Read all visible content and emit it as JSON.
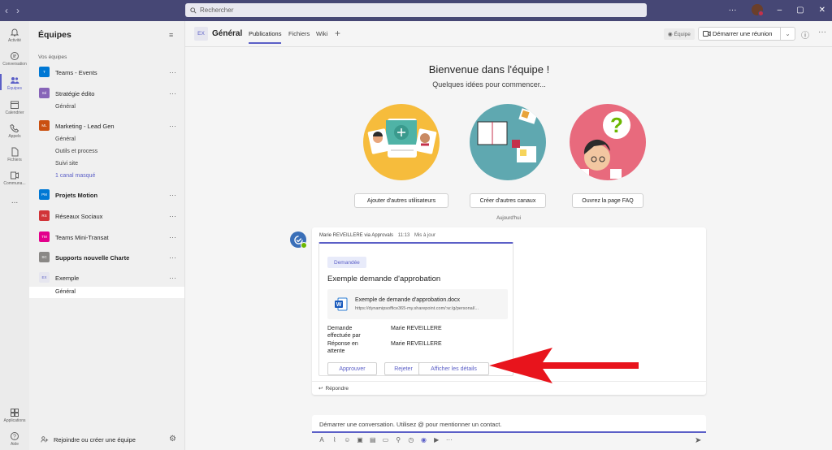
{
  "search": {
    "placeholder": "Rechercher"
  },
  "rail": [
    {
      "label": "Activité",
      "icon": "bell-icon"
    },
    {
      "label": "Conversation",
      "icon": "chat-icon"
    },
    {
      "label": "Équipes",
      "icon": "teams-icon",
      "active": true
    },
    {
      "label": "Calendrier",
      "icon": "calendar-icon"
    },
    {
      "label": "Appels",
      "icon": "phone-icon"
    },
    {
      "label": "Fichiers",
      "icon": "file-icon"
    },
    {
      "label": "Communa...",
      "icon": "communities-icon"
    },
    {
      "label": "...",
      "icon": "more-icon"
    },
    {
      "label": "Applications",
      "icon": "apps-icon"
    },
    {
      "label": "Aide",
      "icon": "help-icon"
    }
  ],
  "teams_panel": {
    "title": "Équipes",
    "section": "Vos équipes",
    "teams": [
      {
        "initials": "T",
        "name": "Teams - Events",
        "color": "#0078d4",
        "bold": false
      },
      {
        "initials": "Sé",
        "name": "Stratégie édito",
        "color": "#8764b8",
        "bold": false
      },
      {
        "initials": "ML",
        "name": "Marketing - Lead Gen",
        "color": "#ca5010",
        "bold": false
      },
      {
        "initials": "PM",
        "name": "Projets Motion",
        "color": "#0078d4",
        "bold": true
      },
      {
        "initials": "RS",
        "name": "Réseaux Sociaux",
        "color": "#d13438",
        "bold": false
      },
      {
        "initials": "TM",
        "name": "Teams Mini-Transat",
        "color": "#e3008c",
        "bold": false
      },
      {
        "initials": "SC",
        "name": "Supports nouvelle Charte",
        "color": "#8a8886",
        "bold": true
      },
      {
        "initials": "EX",
        "name": "Exemple",
        "color": "#e6e6ef",
        "bold": false
      }
    ],
    "channels": {
      "strategie": [
        "Général"
      ],
      "marketing": [
        "Général",
        "Outils et process",
        "Suivi site",
        "1 canal masqué"
      ],
      "exemple": [
        "Général"
      ]
    },
    "footer": "Rejoindre ou créer une équipe"
  },
  "header": {
    "tile": "EX",
    "title": "Général",
    "tabs": [
      "Publications",
      "Fichiers",
      "Wiki"
    ],
    "equipe_label": "Équipe",
    "meet_label": "Démarrer une réunion"
  },
  "welcome": {
    "title": "Bienvenue dans l'équipe !",
    "subtitle": "Quelques idées pour commencer...",
    "actions": [
      "Ajouter d'autres utilisateurs",
      "Créer d'autres canaux",
      "Ouvrez la page FAQ"
    ]
  },
  "feed": {
    "date_divider": "Aujourd'hui",
    "message": {
      "author": "Marie REVEILLERE via Approvals",
      "time": "11:13",
      "edited": "Mis à jour",
      "card": {
        "badge": "Demandée",
        "title": "Exemple demande d'approbation",
        "file_name": "Exemple de demande d'approbation.docx",
        "file_url": "https://dynamipsoffice365-my.sharepoint.com/:w:/g/personal/...",
        "rows": [
          {
            "key": "Demande effectuée par",
            "value": "Marie REVEILLERE"
          },
          {
            "key": "Réponse en attente",
            "value": "Marie REVEILLERE"
          }
        ],
        "buttons": [
          "Approuver",
          "Rejeter",
          "Afficher les détails"
        ]
      },
      "reply": "Répondre"
    }
  },
  "compose": {
    "placeholder": "Démarrer une conversation. Utilisez @ pour mentionner un contact."
  }
}
